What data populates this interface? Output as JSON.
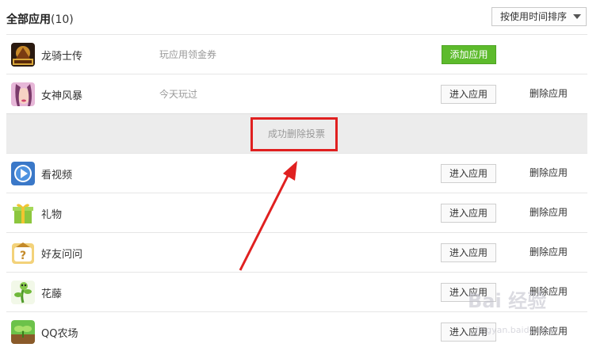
{
  "header": {
    "title": "全部应用",
    "count": "(10)",
    "sort_label": "按使用时间排序"
  },
  "apps": [
    {
      "name": "龙骑士传",
      "note": "玩应用领金券",
      "add_label": "添加应用",
      "icon": "dragon-knight-icon"
    },
    {
      "name": "女神风暴",
      "note": "今天玩过",
      "enter_label": "进入应用",
      "delete_label": "删除应用",
      "icon": "goddess-storm-icon"
    },
    {
      "name": "看视频",
      "enter_label": "进入应用",
      "delete_label": "删除应用",
      "icon": "video-play-icon"
    },
    {
      "name": "礼物",
      "enter_label": "进入应用",
      "delete_label": "删除应用",
      "icon": "gift-icon"
    },
    {
      "name": "好友问问",
      "enter_label": "进入应用",
      "delete_label": "删除应用",
      "icon": "friend-question-icon"
    },
    {
      "name": "花藤",
      "enter_label": "进入应用",
      "delete_label": "删除应用",
      "icon": "flower-vine-icon"
    },
    {
      "name": "QQ农场",
      "enter_label": "进入应用",
      "delete_label": "删除应用",
      "icon": "qq-farm-icon"
    }
  ],
  "notice": {
    "text": "成功删除投票"
  },
  "watermark": {
    "text": "Bai 经验",
    "sub": "jingyan.baidu.com"
  },
  "colors": {
    "add_button": "#5dbb2c",
    "highlight": "#e02020",
    "notice_bg": "#ececec"
  }
}
